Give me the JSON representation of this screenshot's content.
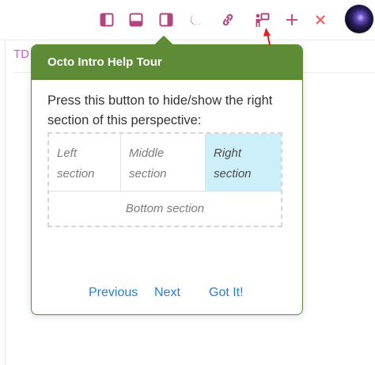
{
  "toolbar": {
    "icons": [
      {
        "name": "left-panel-toggle-icon",
        "color": "#b2457e"
      },
      {
        "name": "bottom-panel-toggle-icon",
        "color": "#b2457e"
      },
      {
        "name": "right-panel-toggle-icon",
        "color": "#b2457e"
      },
      {
        "name": "moon-icon",
        "color": "#b2457e"
      },
      {
        "name": "link-icon",
        "color": "#b2457e"
      },
      {
        "name": "help-tour-icon",
        "color": "#b2457e"
      },
      {
        "name": "plus-icon",
        "color": "#c64e8b"
      },
      {
        "name": "close-icon",
        "color": "#f05f5f"
      }
    ]
  },
  "background": {
    "tab_label": "TD"
  },
  "popover": {
    "title": "Octo Intro Help Tour",
    "description": "Press this button to hide/show the right section of this perspective:",
    "diagram": {
      "left": "Left section",
      "middle": "Middle section",
      "right": "Right section",
      "bottom": "Bottom section"
    },
    "buttons": {
      "previous": "Previous",
      "next": "Next",
      "got_it": "Got It!"
    }
  },
  "colors": {
    "header_green": "#5e8b35",
    "link_blue": "#2a7fd3",
    "highlight": "#cdeff9",
    "annotation_red": "#e02020"
  }
}
